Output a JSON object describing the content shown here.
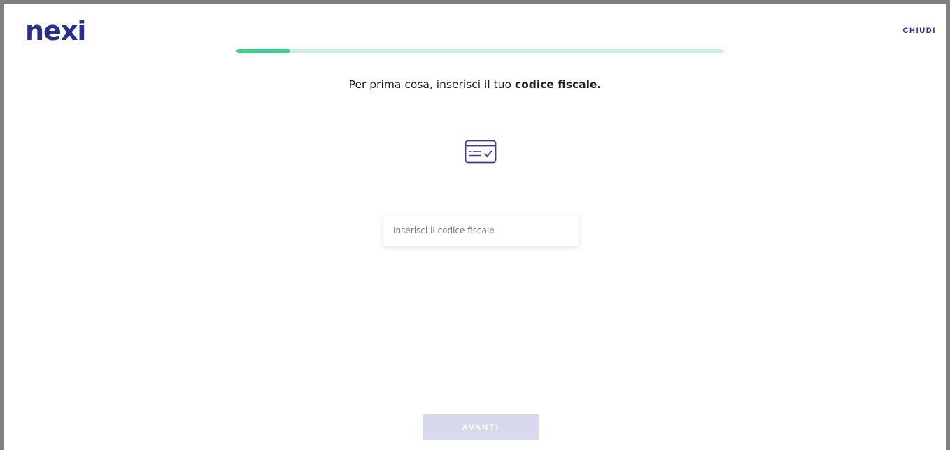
{
  "header": {
    "logo_text": "nexi",
    "close_label": "CHIUDI"
  },
  "progress": {
    "value": 0.11
  },
  "main": {
    "headline_prefix": "Per prima cosa, inserisci il tuo ",
    "headline_bold": "codice fiscale."
  },
  "icons": {
    "id_card": "id-card-check-icon"
  },
  "form": {
    "tax_code_placeholder": "Inserisci il codice fiscale",
    "tax_code_value": ""
  },
  "footer": {
    "next_label": "AVANTI"
  },
  "colors": {
    "brand": "#2b2d8c",
    "progress_fill": "#3fcf8e",
    "progress_track": "#c9f0dd",
    "button_disabled": "#d9d9ee"
  }
}
